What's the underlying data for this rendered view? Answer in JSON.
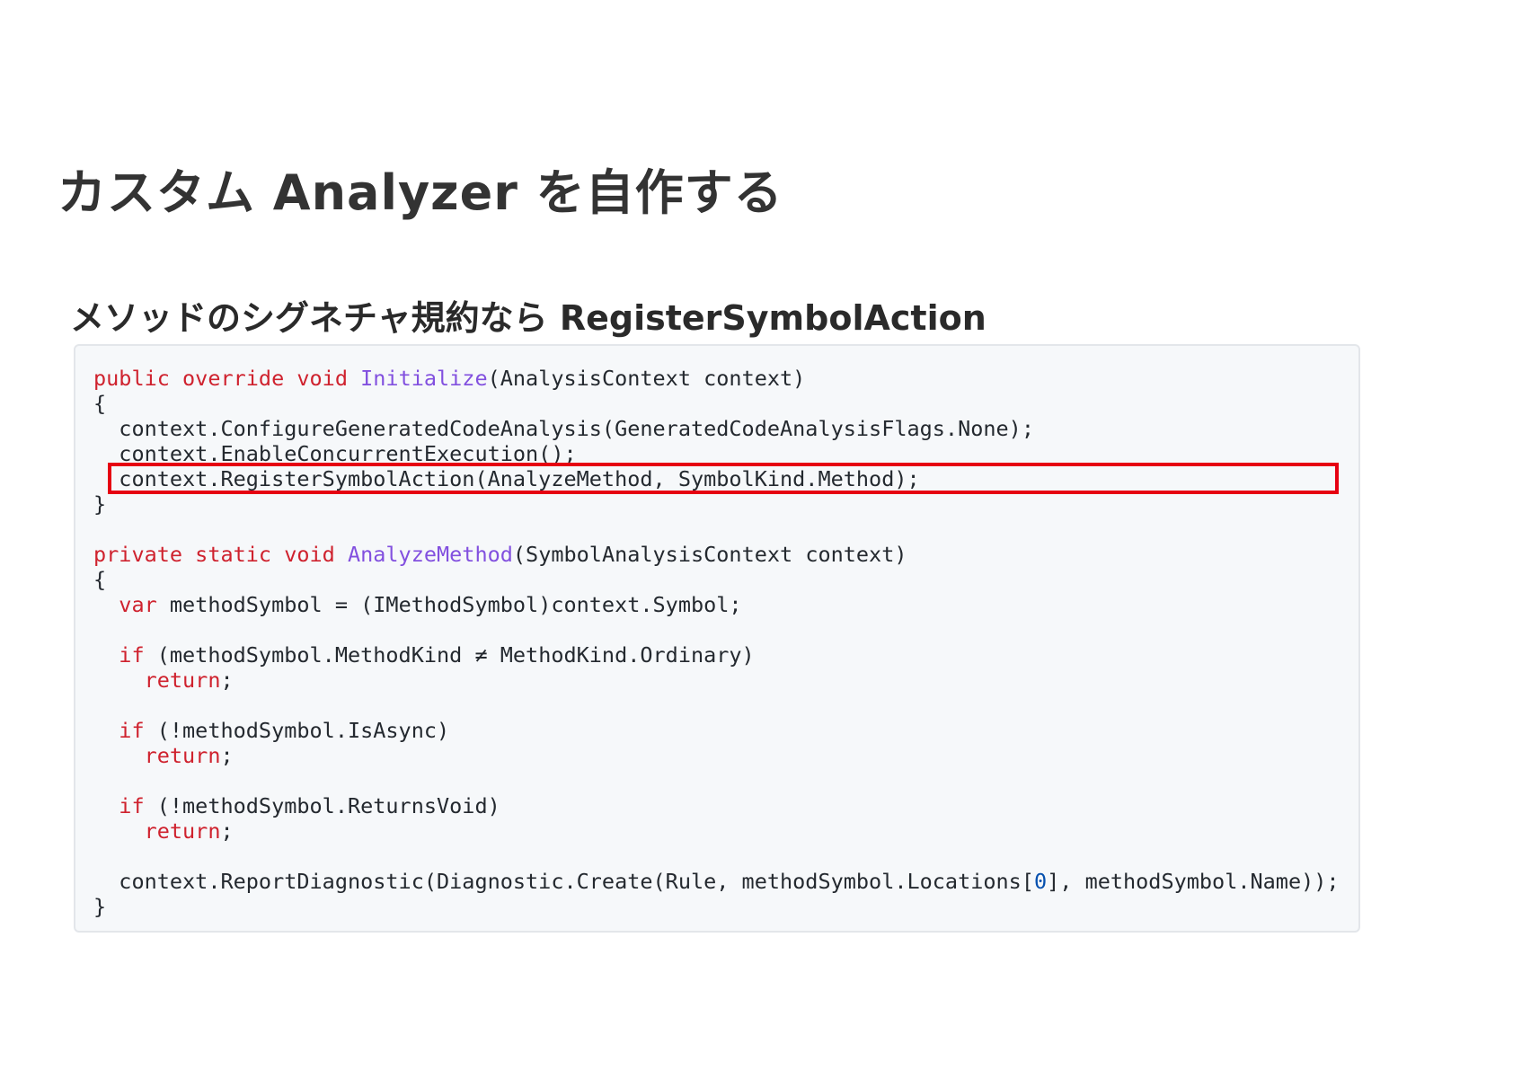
{
  "slide": {
    "title": "カスタム Analyzer を自作する",
    "heading": "メソッドのシグネチャ規約なら RegisterSymbolAction"
  },
  "colors": {
    "keyword": "#cf222e",
    "function": "#8250df",
    "number": "#0550ae",
    "text": "#24292f",
    "code_background": "#f6f8fa",
    "highlight_border": "#e60012"
  },
  "code": {
    "highlighted_line_index": 4,
    "lines": [
      [
        {
          "t": "public override void ",
          "c": "kw"
        },
        {
          "t": "Initialize",
          "c": "fn"
        },
        {
          "t": "(AnalysisContext context)",
          "c": ""
        }
      ],
      [
        {
          "t": "{",
          "c": ""
        }
      ],
      [
        {
          "t": "  context.ConfigureGeneratedCodeAnalysis(GeneratedCodeAnalysisFlags.None);",
          "c": ""
        }
      ],
      [
        {
          "t": "  context.EnableConcurrentExecution();",
          "c": ""
        }
      ],
      [
        {
          "t": "  context.RegisterSymbolAction(AnalyzeMethod, SymbolKind.Method);",
          "c": ""
        }
      ],
      [
        {
          "t": "}",
          "c": ""
        }
      ],
      [],
      [
        {
          "t": "private static void ",
          "c": "kw"
        },
        {
          "t": "AnalyzeMethod",
          "c": "fn"
        },
        {
          "t": "(SymbolAnalysisContext context)",
          "c": ""
        }
      ],
      [
        {
          "t": "{",
          "c": ""
        }
      ],
      [
        {
          "t": "  ",
          "c": ""
        },
        {
          "t": "var",
          "c": "kw"
        },
        {
          "t": " methodSymbol = (IMethodSymbol)context.Symbol;",
          "c": ""
        }
      ],
      [],
      [
        {
          "t": "  ",
          "c": ""
        },
        {
          "t": "if",
          "c": "kw"
        },
        {
          "t": " (methodSymbol.MethodKind ≠ MethodKind.Ordinary)",
          "c": ""
        }
      ],
      [
        {
          "t": "    ",
          "c": ""
        },
        {
          "t": "return",
          "c": "kw"
        },
        {
          "t": ";",
          "c": ""
        }
      ],
      [],
      [
        {
          "t": "  ",
          "c": ""
        },
        {
          "t": "if",
          "c": "kw"
        },
        {
          "t": " (!methodSymbol.IsAsync)",
          "c": ""
        }
      ],
      [
        {
          "t": "    ",
          "c": ""
        },
        {
          "t": "return",
          "c": "kw"
        },
        {
          "t": ";",
          "c": ""
        }
      ],
      [],
      [
        {
          "t": "  ",
          "c": ""
        },
        {
          "t": "if",
          "c": "kw"
        },
        {
          "t": " (!methodSymbol.ReturnsVoid)",
          "c": ""
        }
      ],
      [
        {
          "t": "    ",
          "c": ""
        },
        {
          "t": "return",
          "c": "kw"
        },
        {
          "t": ";",
          "c": ""
        }
      ],
      [],
      [
        {
          "t": "  context.ReportDiagnostic(Diagnostic.Create(Rule, methodSymbol.Locations[",
          "c": ""
        },
        {
          "t": "0",
          "c": "num"
        },
        {
          "t": "], methodSymbol.Name));",
          "c": ""
        }
      ],
      [
        {
          "t": "}",
          "c": ""
        }
      ]
    ]
  }
}
